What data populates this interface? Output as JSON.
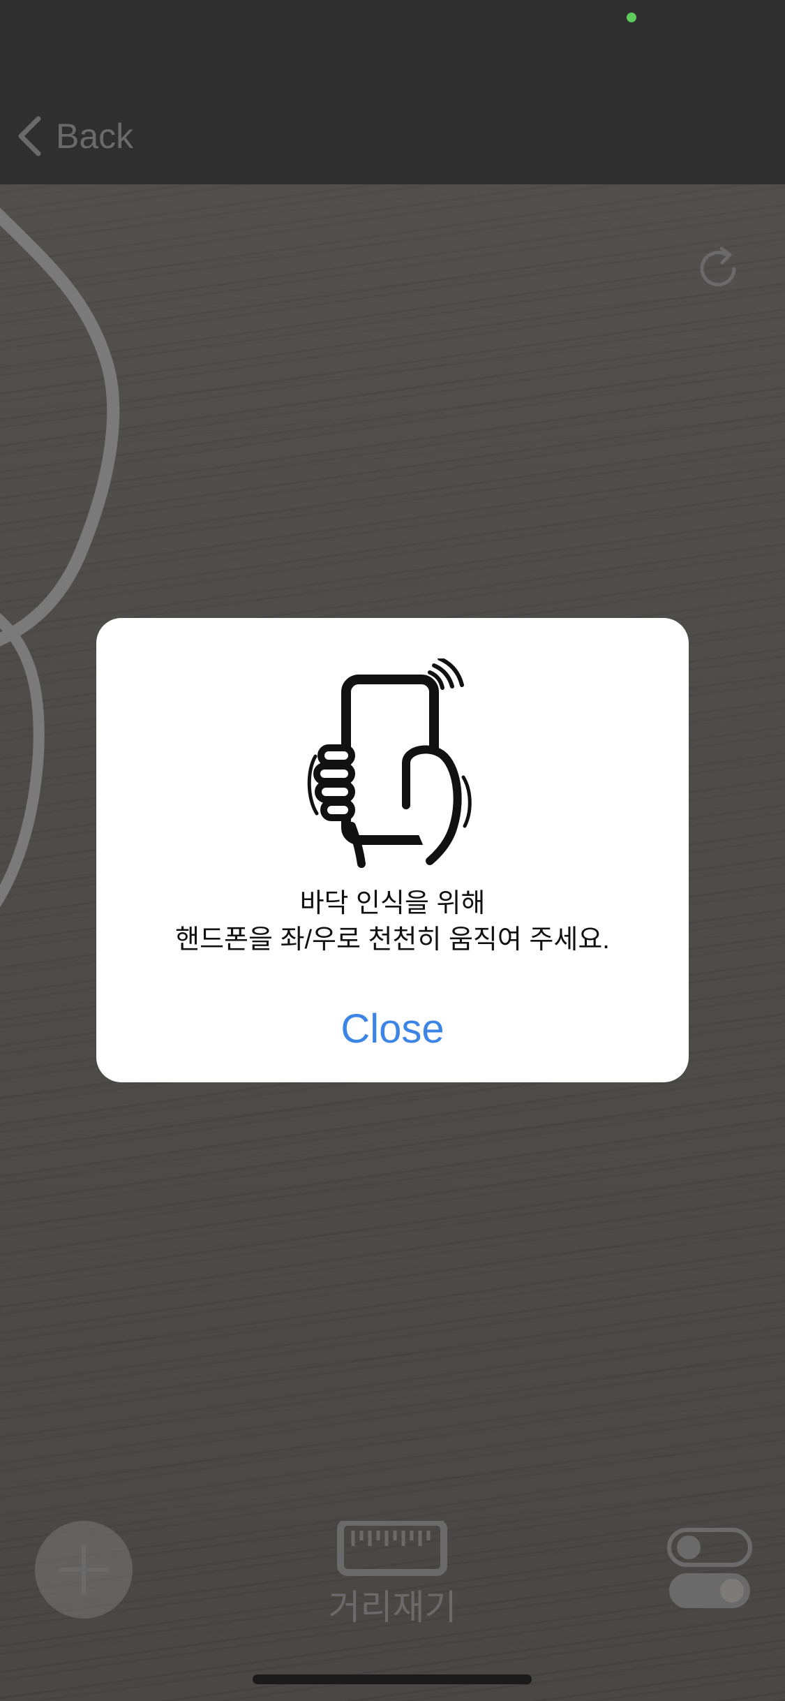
{
  "nav": {
    "back_label": "Back"
  },
  "dialog": {
    "message_line1": "바닥 인식을 위해",
    "message_line2": "핸드폰을 좌/우로 천천히 움직여 주세요.",
    "close_label": "Close",
    "illustration": "hand-holding-phone-icon"
  },
  "toolbar": {
    "add_icon": "plus-icon",
    "measure_icon": "ruler-icon",
    "measure_label": "거리재기",
    "settings_icon": "toggle-icon"
  },
  "status": {
    "privacy_indicator_color": "#5ecb5a"
  },
  "colors": {
    "accent": "#3c84e6",
    "dialog_bg": "#ffffff",
    "nav_bg": "#2f2f2f"
  }
}
